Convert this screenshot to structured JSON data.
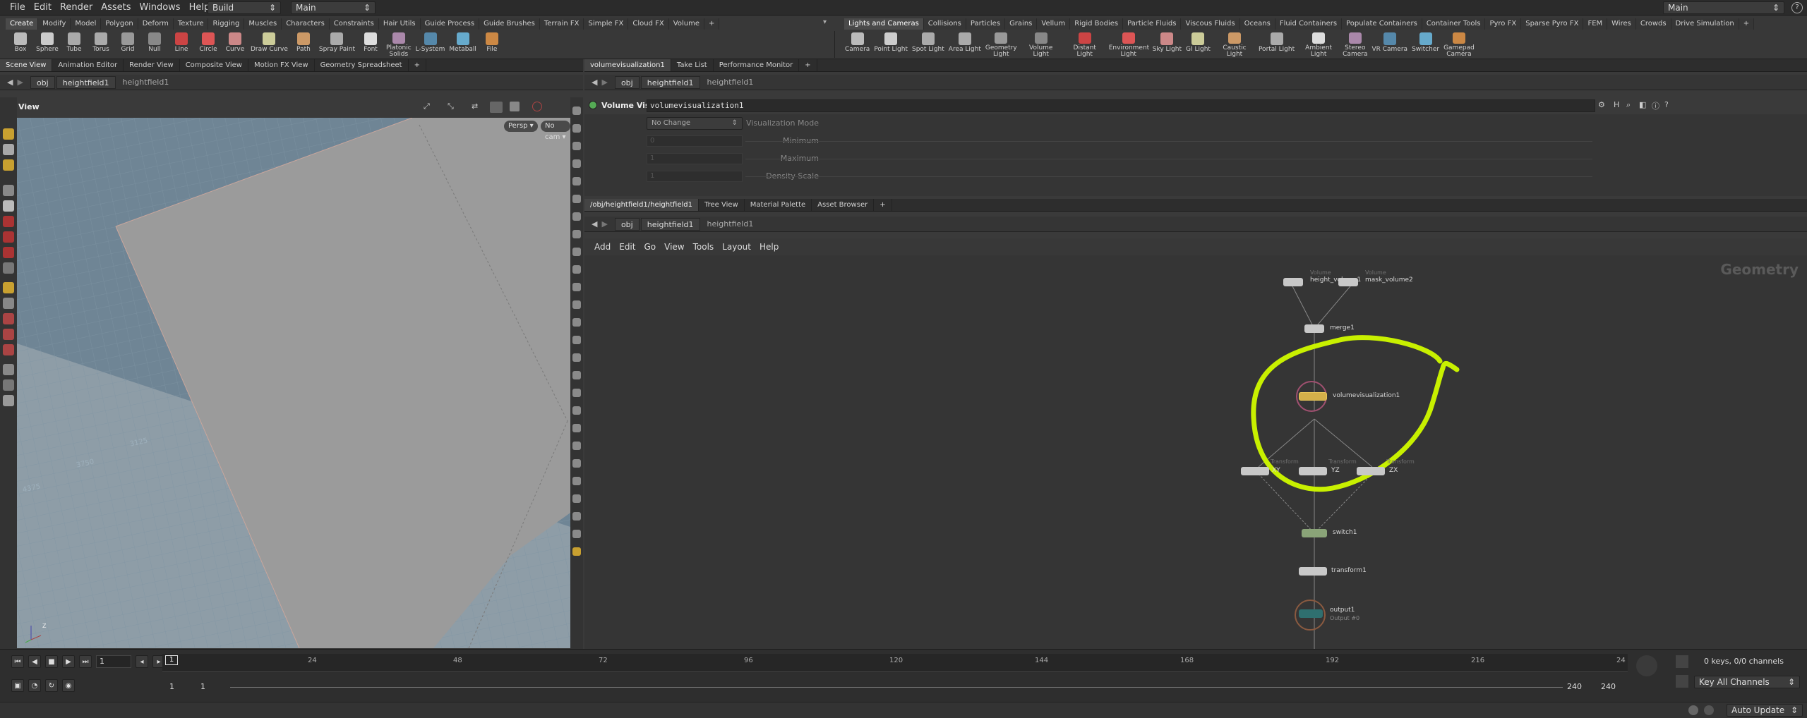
{
  "menubar": {
    "items": [
      "File",
      "Edit",
      "Render",
      "Assets",
      "Windows",
      "Help"
    ],
    "desktop": "Build",
    "context": "Main",
    "right_combo": "Main"
  },
  "shelf_left": {
    "tabs": [
      "Create",
      "Modify",
      "Model",
      "Polygon",
      "Deform",
      "Texture",
      "Rigging",
      "Muscles",
      "Characters",
      "Constraints",
      "Hair Utils",
      "Guide Process",
      "Guide Brushes",
      "Terrain FX",
      "Simple FX",
      "Cloud FX",
      "Volume"
    ],
    "tools": [
      "Box",
      "Sphere",
      "Tube",
      "Torus",
      "Grid",
      "Null",
      "Line",
      "Circle",
      "Curve",
      "Draw Curve",
      "Path",
      "Spray Paint",
      "Font",
      "Platonic\nSolids",
      "L-System",
      "Metaball",
      "File"
    ]
  },
  "shelf_right": {
    "tabs": [
      "Lights and Cameras",
      "Collisions",
      "Particles",
      "Grains",
      "Vellum",
      "Rigid Bodies",
      "Particle Fluids",
      "Viscous Fluids",
      "Oceans",
      "Fluid Containers",
      "Populate Containers",
      "Container Tools",
      "Pyro FX",
      "Sparse Pyro FX",
      "FEM",
      "Wires",
      "Crowds",
      "Drive Simulation"
    ],
    "tools": [
      "Camera",
      "Point Light",
      "Spot Light",
      "Area Light",
      "Geometry\nLight",
      "Volume Light",
      "Distant Light",
      "Environment\nLight",
      "Sky Light",
      "GI Light",
      "Caustic Light",
      "Portal Light",
      "Ambient Light",
      "Stereo\nCamera",
      "VR Camera",
      "Switcher",
      "Gamepad\nCamera"
    ]
  },
  "left_pane": {
    "tabs": [
      "Scene View",
      "Animation Editor",
      "Render View",
      "Composite View",
      "Motion FX View",
      "Geometry Spreadsheet"
    ],
    "path": [
      "obj",
      "heightfield1",
      "heightfield1"
    ],
    "view_label": "View",
    "persp": "Persp",
    "camera": "No cam",
    "grid_labels": [
      "3125",
      "3750",
      "4375"
    ],
    "axis_z": "Z"
  },
  "params_pane": {
    "tabs": [
      "volumevisualization1",
      "Take List",
      "Performance Monitor"
    ],
    "path": [
      "obj",
      "heightfield1",
      "heightfield1"
    ],
    "node_type": "Volume Visualization",
    "node_name": "volumevisualization1",
    "rows": [
      {
        "label": "Visualization Mode",
        "value": "No Change"
      },
      {
        "label": "Minimum",
        "value": "0"
      },
      {
        "label": "Maximum",
        "value": "1"
      },
      {
        "label": "Density Scale",
        "value": "1"
      }
    ]
  },
  "network_pane": {
    "tabs": [
      "/obj/heightfield1/heightfield1",
      "Tree View",
      "Material Palette",
      "Asset Browser"
    ],
    "path": [
      "obj",
      "heightfield1",
      "heightfield1"
    ],
    "menu": [
      "Add",
      "Edit",
      "Go",
      "View",
      "Tools",
      "Layout",
      "Help"
    ],
    "context_label": "Geometry",
    "nodes": [
      {
        "name": "height_volume1",
        "sub": "Volume"
      },
      {
        "name": "mask_volume2",
        "sub": "Volume"
      },
      {
        "name": "merge1",
        "sub": ""
      },
      {
        "name": "volumevisualization1",
        "sub": ""
      },
      {
        "name": "XY",
        "sub": "Transform"
      },
      {
        "name": "YZ",
        "sub": "Transform"
      },
      {
        "name": "ZX",
        "sub": "Transform"
      },
      {
        "name": "switch1",
        "sub": ""
      },
      {
        "name": "transform1",
        "sub": ""
      },
      {
        "name": "output1",
        "sub": "Output #0"
      }
    ]
  },
  "timeline": {
    "frame": "1",
    "ticks": [
      "24",
      "48",
      "72",
      "96",
      "120",
      "144",
      "168",
      "192",
      "216",
      "24"
    ],
    "range_start": "1",
    "range_start2": "1",
    "range_end": "240",
    "range_end2": "240",
    "keys_info": "0 keys, 0/0 channels",
    "key_mode": "Key All Channels",
    "update_mode": "Auto Update"
  },
  "colors": {
    "highlight": "#c8f000",
    "viewport_bg": "#6f8595",
    "plane": "#9b9b9b"
  }
}
